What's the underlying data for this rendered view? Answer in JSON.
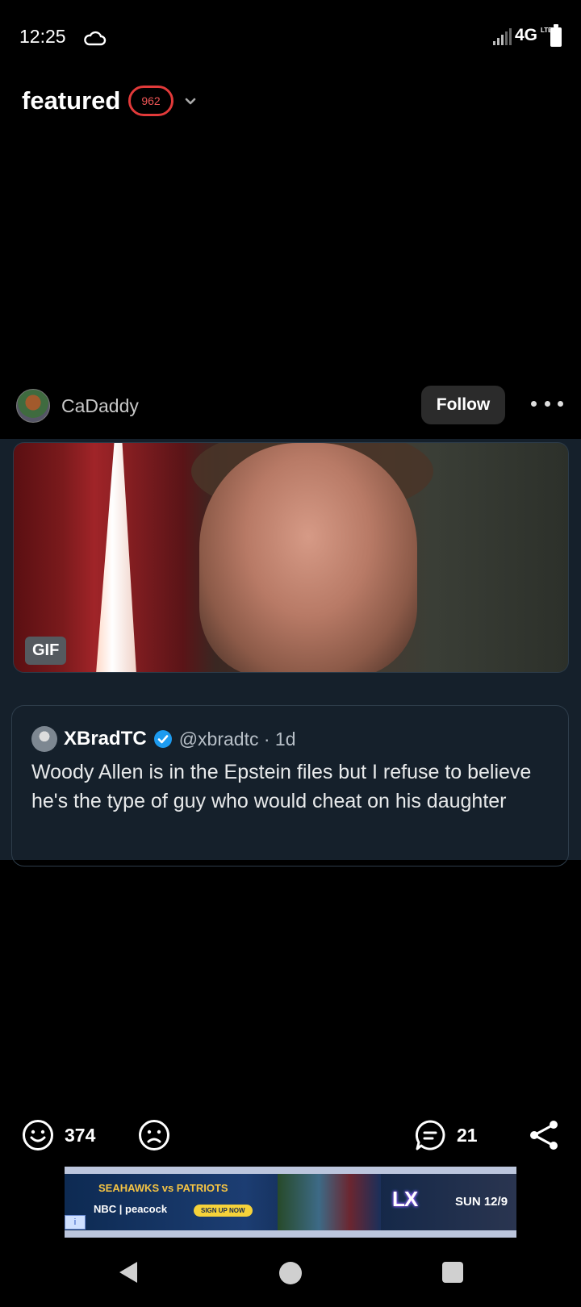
{
  "status_bar": {
    "time": "12:25",
    "network": "4G",
    "network_sub": "LTE"
  },
  "header": {
    "title": "featured",
    "badge": "962"
  },
  "author": {
    "name": "CaDaddy",
    "follow_label": "Follow"
  },
  "post": {
    "gif_label": "GIF",
    "quote": {
      "name": "XBradTC",
      "handle": "@xbradtc · 1d",
      "text": "Woody Allen is in the Epstein files but I refuse to believe he's the type of guy who would cheat on his daughter"
    }
  },
  "actions": {
    "upvotes": "374",
    "comments": "21"
  },
  "ad": {
    "matchup": "SEAHAWKS vs PATRIOTS",
    "brands": "NBC | peacock",
    "signup": "SIGN UP NOW",
    "event_logo": "LX",
    "date": "SUN 12/9"
  },
  "icons": {
    "cloud": "cloud-icon",
    "signal": "signal-icon",
    "battery": "battery-icon",
    "chevron": "chevron-down-icon",
    "more": "more-icon",
    "verified": "verified-icon",
    "upvote": "smile-icon",
    "downvote": "frown-icon",
    "comment": "comment-icon",
    "share": "share-icon"
  },
  "colors": {
    "badge": "#e23a3a",
    "post_bg": "#15202b",
    "verified": "#1d9bf0"
  }
}
